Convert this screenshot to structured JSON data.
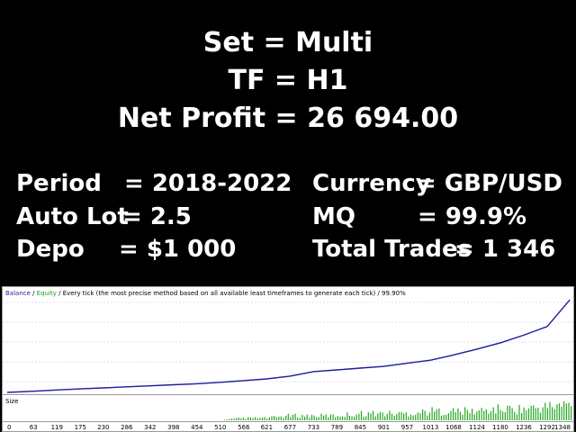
{
  "headline": {
    "set": "Set = Multi",
    "tf": "TF  = H1",
    "net_profit": "Net Profit = 26 694.00"
  },
  "stats": {
    "period_label": "Period",
    "period_value": "= 2018-2022",
    "autolot_label": "Auto Lot",
    "autolot_value": "= 2.5",
    "depo_label": "Depo",
    "depo_value": "= $1 000",
    "currency_label": "Currency",
    "currency_value": "= GBP/USD",
    "mq_label": "MQ",
    "mq_value": "= 99.9%",
    "trades_label": "Total Trades",
    "trades_value": "= 1 346"
  },
  "chart_header": {
    "balance": "Balance",
    "sep1": " / ",
    "equity": "Equity",
    "sep2": " / ",
    "text": "Every tick (the most precise method based on all available least timeframes to generate each tick)",
    "sep3": " / ",
    "quality": "99.90%"
  },
  "size_label": "Size",
  "colors": {
    "balance": "#1f1fa0",
    "equity": "#1a9c1a",
    "size_bars": "#22a822"
  },
  "chart_data": {
    "type": "line",
    "x_ticks": [
      "0",
      "63",
      "119",
      "175",
      "230",
      "286",
      "342",
      "398",
      "454",
      "510",
      "566",
      "621",
      "677",
      "733",
      "789",
      "845",
      "901",
      "957",
      "1013",
      "1068",
      "1124",
      "1180",
      "1236",
      "1292",
      "1348"
    ],
    "series": [
      {
        "name": "Balance",
        "x": [
          0,
          63,
          119,
          175,
          230,
          286,
          342,
          398,
          454,
          510,
          566,
          621,
          677,
          733,
          789,
          845,
          901,
          957,
          1013,
          1068,
          1124,
          1180,
          1236,
          1292,
          1346
        ],
        "values": [
          0,
          350,
          700,
          1000,
          1300,
          1600,
          1900,
          2200,
          2500,
          2900,
          3400,
          3900,
          4700,
          6000,
          6500,
          7000,
          7500,
          8400,
          9300,
          10800,
          12500,
          14300,
          16500,
          19000,
          26694
        ]
      }
    ],
    "size_values": [
      0,
      0,
      0,
      0,
      0,
      0,
      0,
      0,
      0,
      0,
      1,
      1,
      2,
      2,
      2,
      3,
      3,
      3,
      4,
      4,
      4,
      5,
      5,
      6,
      7
    ],
    "ylim": [
      0,
      27000
    ]
  }
}
